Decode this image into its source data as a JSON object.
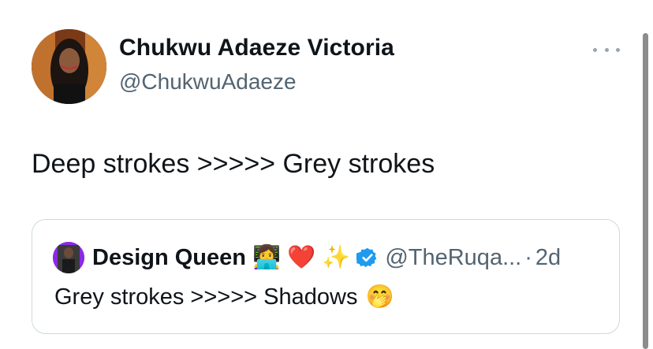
{
  "author": {
    "name": "Chukwu Adaeze Victoria",
    "handle": "@ChukwuAdaeze"
  },
  "tweet": {
    "text": "Deep strokes >>>>> Grey strokes"
  },
  "quote": {
    "name": "Design Queen",
    "emojis": [
      "👩‍💻",
      "❤️",
      "✨"
    ],
    "handle": "@TheRuqa...",
    "separator": "·",
    "time": "2d",
    "text": "Grey strokes >>>>> Shadows",
    "text_emoji": "🤭"
  },
  "icons": {
    "more": "more-icon",
    "verified": "verified-badge-icon"
  },
  "colors": {
    "text": "#0f1419",
    "secondary": "#536471",
    "verified": "#1d9bf0",
    "border": "#cfd9de"
  }
}
